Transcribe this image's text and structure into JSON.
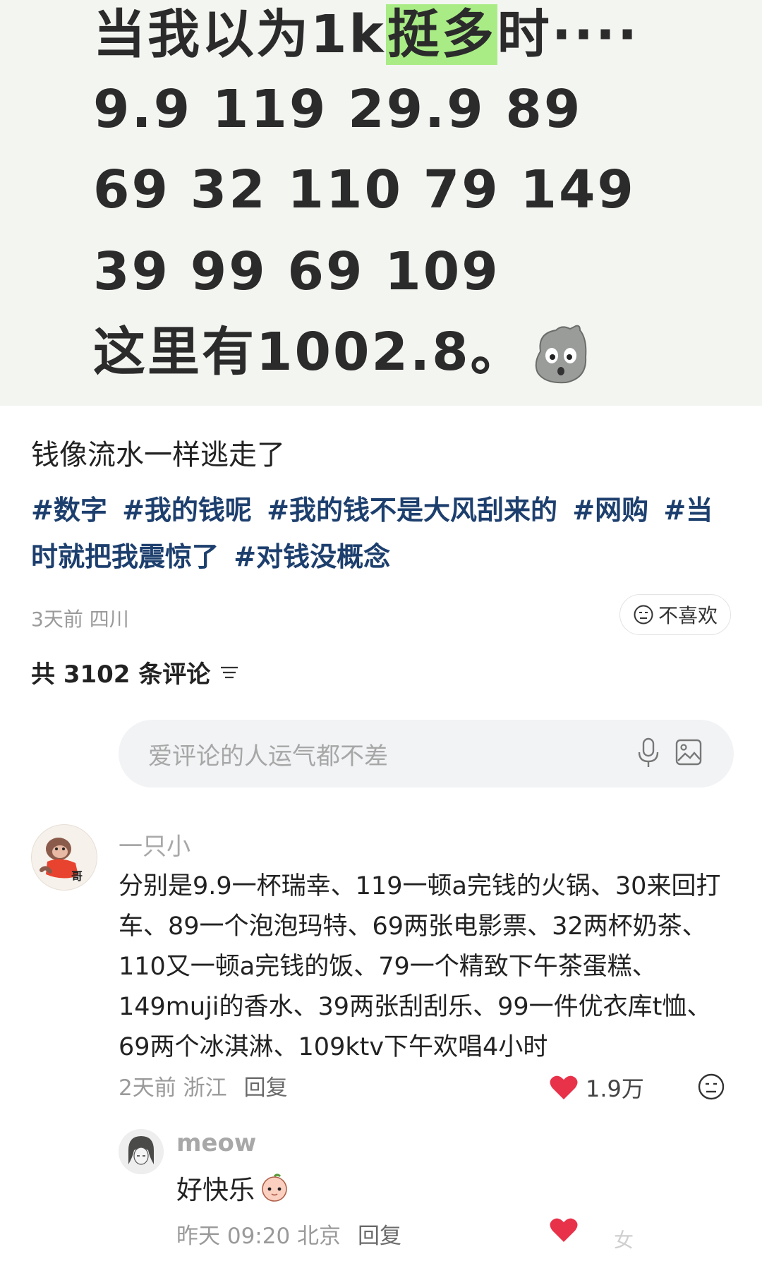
{
  "poster": {
    "line1_a": "当我以为1k",
    "line1_hl": "挺多",
    "line1_b": "时····",
    "line2": "9.9 119 29.9 89",
    "line3": "69 32 110 79 149",
    "line4": "39 99 69 109",
    "line5": "这里有1002.8。"
  },
  "post": {
    "body": "钱像流水一样逃走了",
    "tags": [
      "#数字",
      "#我的钱呢",
      "#我的钱不是大风刮来的",
      "#网购",
      "#当时就把我震惊了",
      "#对钱没概念"
    ],
    "meta": "3天前 四川",
    "dislike_label": "不喜欢"
  },
  "comments_header": {
    "label": "共 3102 条评论"
  },
  "comment_input": {
    "placeholder": "爱评论的人运气都不差"
  },
  "comment1": {
    "user": "一只小",
    "avatar_badge": "哥",
    "text": "分别是9.9一杯瑞幸、119一顿a完钱的火锅、30来回打车、89一个泡泡玛特、69两张电影票、32两杯奶茶、110又一顿a完钱的饭、79一个精致下午茶蛋糕、149muji的香水、39两张刮刮乐、99一件优衣库t恤、69两个冰淇淋、109ktv下午欢唱4小时",
    "time_loc": "2天前 浙江",
    "reply": "回复",
    "likes": "1.9万"
  },
  "reply1": {
    "user": "meow",
    "text": "好快乐",
    "time_loc": "昨天 09:20 北京",
    "reply": "回复"
  },
  "watermark": "女",
  "colors": {
    "highlight": "#a9ec86",
    "tag": "#1d3f6e",
    "like": "#e8324a"
  },
  "icons": [
    "rock-emoji-icon",
    "dislike-face-icon",
    "sort-icon",
    "mic-icon",
    "image-icon",
    "heart-icon",
    "peach-emoji-icon"
  ]
}
